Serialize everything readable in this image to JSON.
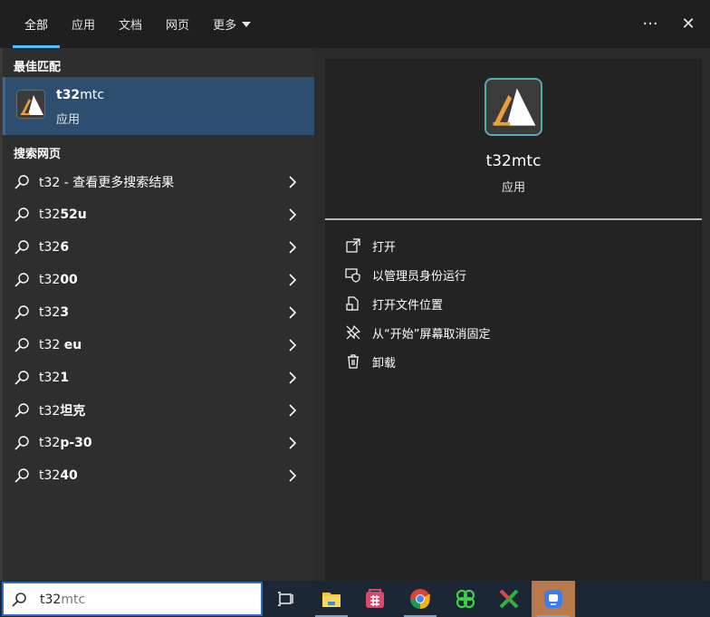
{
  "tabs": [
    {
      "label": "全部",
      "active": true
    },
    {
      "label": "应用"
    },
    {
      "label": "文档"
    },
    {
      "label": "网页"
    },
    {
      "label": "更多"
    }
  ],
  "top_actions": {
    "more_label": "···",
    "close_label": "✕"
  },
  "best_match": {
    "section_title": "最佳匹配",
    "name_bold": "t32",
    "name_rest": "mtc",
    "type": "应用"
  },
  "web": {
    "section_title": "搜索网页",
    "results": [
      {
        "prefix": "t32 - 查看更多搜索结果",
        "bold": ""
      },
      {
        "prefix": "t32",
        "bold": "52u"
      },
      {
        "prefix": "t32",
        "bold": "6"
      },
      {
        "prefix": "t32",
        "bold": "00"
      },
      {
        "prefix": "t32",
        "bold": "3"
      },
      {
        "prefix": "t32 ",
        "bold": "eu"
      },
      {
        "prefix": "t32",
        "bold": "1"
      },
      {
        "prefix": "t32",
        "bold": "坦克"
      },
      {
        "prefix": "t32",
        "bold": "p-30"
      },
      {
        "prefix": "t32",
        "bold": "40"
      }
    ]
  },
  "detail": {
    "name": "t32mtc",
    "type": "应用",
    "actions": [
      {
        "label": "打开",
        "icon": "open-icon"
      },
      {
        "label": "以管理员身份运行",
        "icon": "shield-icon"
      },
      {
        "label": "打开文件位置",
        "icon": "file-location-icon"
      },
      {
        "label": "从“开始”屏幕取消固定",
        "icon": "unpin-icon"
      },
      {
        "label": "卸载",
        "icon": "trash-icon"
      }
    ]
  },
  "taskbar": {
    "search_typed": "t32",
    "search_suggest": "mtc",
    "apps": [
      "task-view-icon",
      "file-explorer-icon",
      "store-app-icon",
      "chrome-icon",
      "green-app-icon",
      "xmind-icon",
      "mi-app-icon"
    ]
  },
  "colors": {
    "accent": "#4cc2ff",
    "selected": "#2d4e6e",
    "taskbar_active": "#b97a4b"
  }
}
